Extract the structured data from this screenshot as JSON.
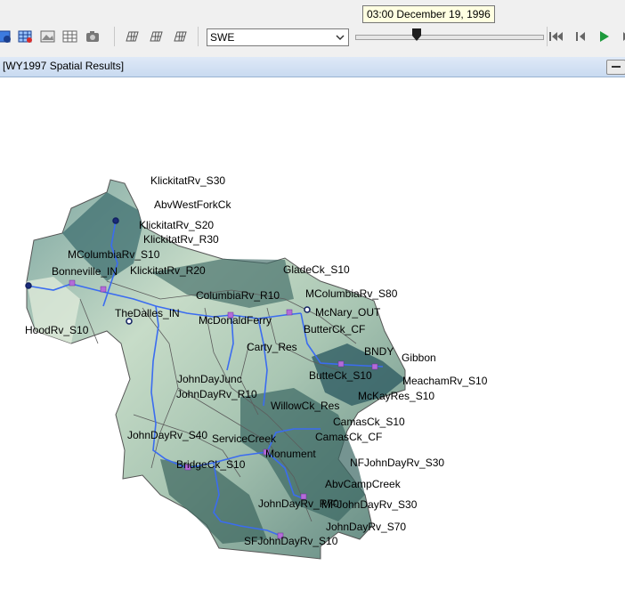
{
  "toolbar": {
    "tooltip": "03:00 December 19, 1996",
    "variable_select": {
      "selected": "SWE"
    },
    "icons": [
      "map-layer-icon",
      "map-grid-icon",
      "map-image-icon",
      "table-icon",
      "camera-icon",
      "globe-grid-icon",
      "globe-grid-2-icon",
      "globe-grid-3-icon"
    ],
    "playback": [
      "rewind-icon",
      "step-back-icon",
      "play-icon",
      "step-forward-icon"
    ],
    "slider_position": 0.33
  },
  "window": {
    "title": "[WY1997 Spatial Results]"
  },
  "colors": {
    "river": "#3b6cf0",
    "node": "#b46cd8",
    "accent": "#1d9a3c"
  },
  "map": {
    "labels": [
      "KlickitatRv_S30",
      "AbvWestForkCk",
      "KlickitatRv_S20",
      "KlickitatRv_R30",
      "MColumbiaRv_S10",
      "Bonneville_IN",
      "KlickitatRv_R20",
      "GladeCk_S10",
      "ColumbiaRv_R10",
      "MColumbiaRv_S80",
      "TheDalles_IN",
      "McDonaldFerry",
      "McNary_OUT",
      "HoodRv_S10",
      "ButterCk_CF",
      "Carty_Res",
      "BNDY",
      "Gibbon",
      "ButteCk_S10",
      "MeachamRv_S10",
      "JohnDayJunc",
      "McKayRes_S10",
      "JohnDayRv_R10",
      "WillowCk_Res",
      "CamasCk_S10",
      "JohnDayRv_S40",
      "ServiceCreek",
      "CamasCk_CF",
      "Monument",
      "NFJohnDayRv_S30",
      "BridgeCk_S10",
      "AbvCampCreek",
      "JohnDayRv_R70",
      "MFJohnDayRv_S30",
      "JohnDayRv_S70",
      "SFJohnDayRv_S10"
    ]
  }
}
